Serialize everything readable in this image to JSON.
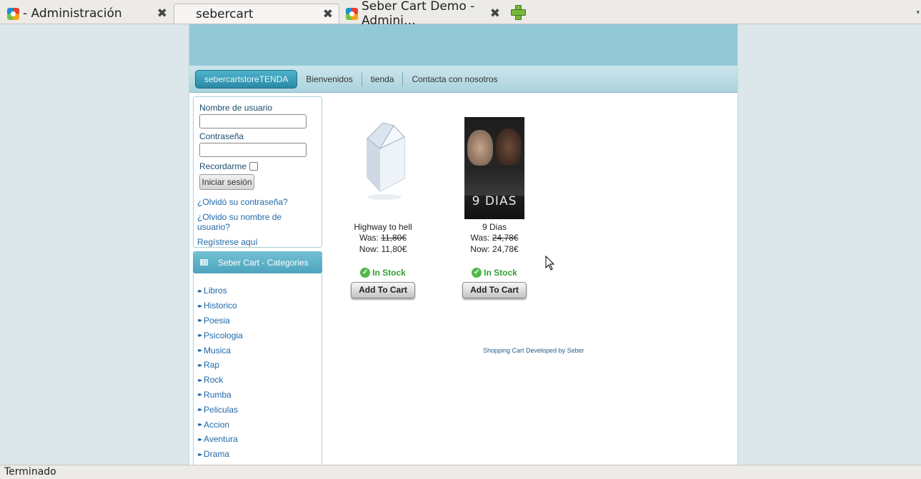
{
  "browser": {
    "tabs": [
      {
        "icon": "joomla-icon",
        "title": "- Administración"
      },
      {
        "icon": "page-icon",
        "title": "sebercart"
      },
      {
        "icon": "joomla-icon",
        "title": "Seber Cart Demo - Admini…"
      }
    ],
    "close_glyph": "✖",
    "menu_glyph": "▾"
  },
  "nav": {
    "items": [
      "sebercartstoreTENDA",
      "Bienvenidos",
      "tienda",
      "Contacta con nosotros"
    ]
  },
  "login": {
    "username_label": "Nombre de usuario",
    "password_label": "Contraseña",
    "remember_label": "Recordarme",
    "submit_label": "Iniciar sesión",
    "links": [
      "¿Olvidó su contraseña?",
      "¿Olvido su nombre de usuario?",
      "Regístrese aquí"
    ]
  },
  "categories": {
    "title": "Seber Cart - Categories",
    "items": [
      "Libros",
      "Historico",
      "Poesia",
      "Psicologia",
      "Musica",
      "Rap",
      "Rock",
      "Rumba",
      "Peliculas",
      "Accion",
      "Aventura",
      "Drama"
    ]
  },
  "products": [
    {
      "name": "Highway to hell",
      "was_label": "Was:",
      "was_price": "11,80€",
      "now_label": "Now:",
      "now_price": "11,80€",
      "stock": "In Stock",
      "button": "Add To Cart"
    },
    {
      "name": "9 Dias",
      "was_label": "Was:",
      "was_price": "24,78€",
      "now_label": "Now:",
      "now_price": "24,78€",
      "stock": "In Stock",
      "button": "Add To Cart",
      "poster_text": "9 DIAS"
    }
  ],
  "footer": "Shopping Cart Developed by Seber",
  "status": "Terminado",
  "colors": {
    "banner": "#93c9d6",
    "nav_active": "#2a8aa6",
    "link": "#2069a8",
    "stock": "#32a032"
  }
}
